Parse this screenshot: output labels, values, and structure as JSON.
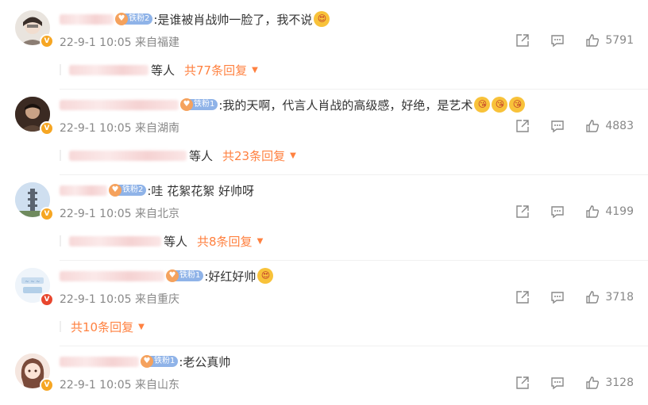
{
  "comments": [
    {
      "fan_label": "铁粉2",
      "text": ":是谁被肖战帅一脸了，我不说",
      "emojis": [
        "😍"
      ],
      "time": "22-9-1 10:05",
      "location": "来自福建",
      "likes": "5791",
      "reply_deng": "等人",
      "reply_total": "共77条回复",
      "badge": "yellow"
    },
    {
      "fan_label": "铁粉1",
      "text": ":我的天啊，代言人肖战的高级感，好绝，是艺术",
      "emojis": [
        "😘",
        "😘",
        "😘"
      ],
      "time": "22-9-1 10:05",
      "location": "来自湖南",
      "likes": "4883",
      "reply_deng": "等人",
      "reply_total": "共23条回复",
      "badge": "yellow"
    },
    {
      "fan_label": "铁粉2",
      "text": ":哇 花絮花絮 好帅呀",
      "emojis": [],
      "time": "22-9-1 10:05",
      "location": "来自北京",
      "likes": "4199",
      "reply_deng": "等人",
      "reply_total": "共8条回复",
      "badge": "yellow"
    },
    {
      "fan_label": "铁粉1",
      "text": ":好红好帅",
      "emojis": [
        "😍"
      ],
      "time": "22-9-1 10:05",
      "location": "来自重庆",
      "likes": "3718",
      "reply_deng": "",
      "reply_total": "共10条回复",
      "badge": "red"
    },
    {
      "fan_label": "铁粉1",
      "text": ":老公真帅",
      "emojis": [],
      "time": "22-9-1 10:05",
      "location": "来自山东",
      "likes": "3128",
      "badge": "yellow"
    }
  ],
  "icons": {
    "share": "share-icon",
    "comment": "comment-icon",
    "like": "like-icon"
  },
  "colors": {
    "accent": "#ff8140",
    "meta": "#888888",
    "fan_badge": "#8fb3e8"
  }
}
